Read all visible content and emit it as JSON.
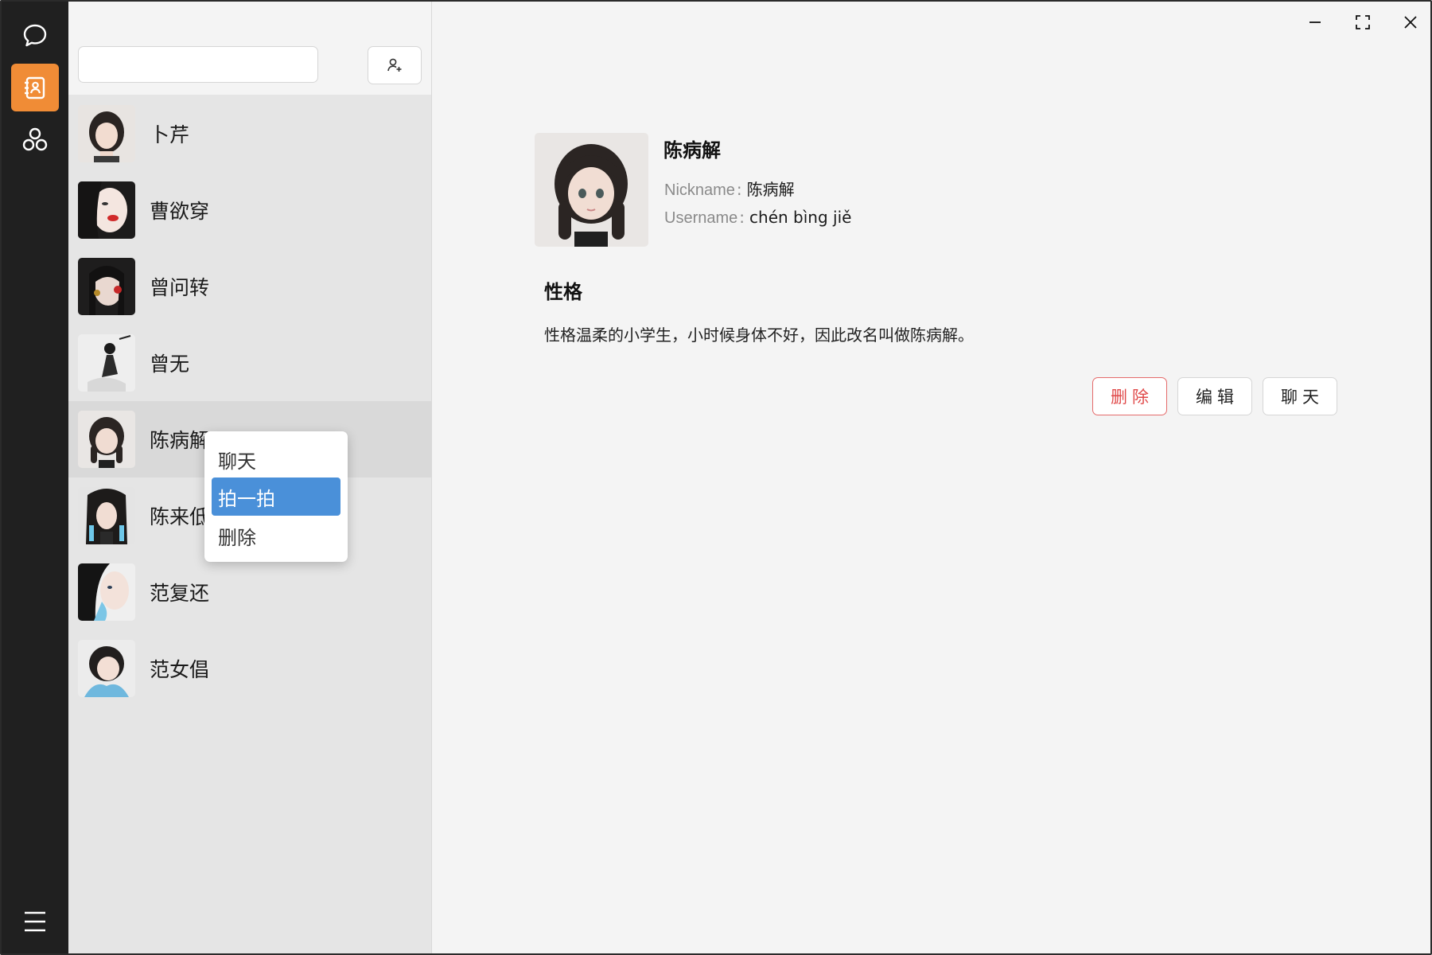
{
  "app": {
    "accent": "#f08c36",
    "highlight": "#4a90d9"
  },
  "rail": {
    "items": [
      {
        "icon": "chat-bubble-icon",
        "active": false
      },
      {
        "icon": "contacts-book-icon",
        "active": true
      },
      {
        "icon": "groups-icon",
        "active": false
      }
    ],
    "menu_icon": "hamburger-menu-icon"
  },
  "search": {
    "value": "",
    "placeholder": ""
  },
  "add_contact_icon": "add-user-icon",
  "contacts": [
    {
      "name": "卜芹"
    },
    {
      "name": "曹欲穿"
    },
    {
      "name": "曾问转"
    },
    {
      "name": "曾无"
    },
    {
      "name": "陈病解",
      "selected": true
    },
    {
      "name": "陈来低"
    },
    {
      "name": "范复还"
    },
    {
      "name": "范女倡"
    }
  ],
  "context_menu": {
    "items": [
      {
        "label": "聊天"
      },
      {
        "label": "拍一拍",
        "highlighted": true
      },
      {
        "label": "删除"
      }
    ]
  },
  "detail": {
    "name": "陈病解",
    "nickname_label": "Nickname",
    "nickname": "陈病解",
    "username_label": "Username",
    "username": "chén bìng jiě",
    "separator": ":",
    "section_title": "性格",
    "section_text": "性格温柔的小学生，小时候身体不好，因此改名叫做陈病解。",
    "buttons": {
      "delete": "删除",
      "edit": "编辑",
      "chat": "聊天"
    }
  }
}
